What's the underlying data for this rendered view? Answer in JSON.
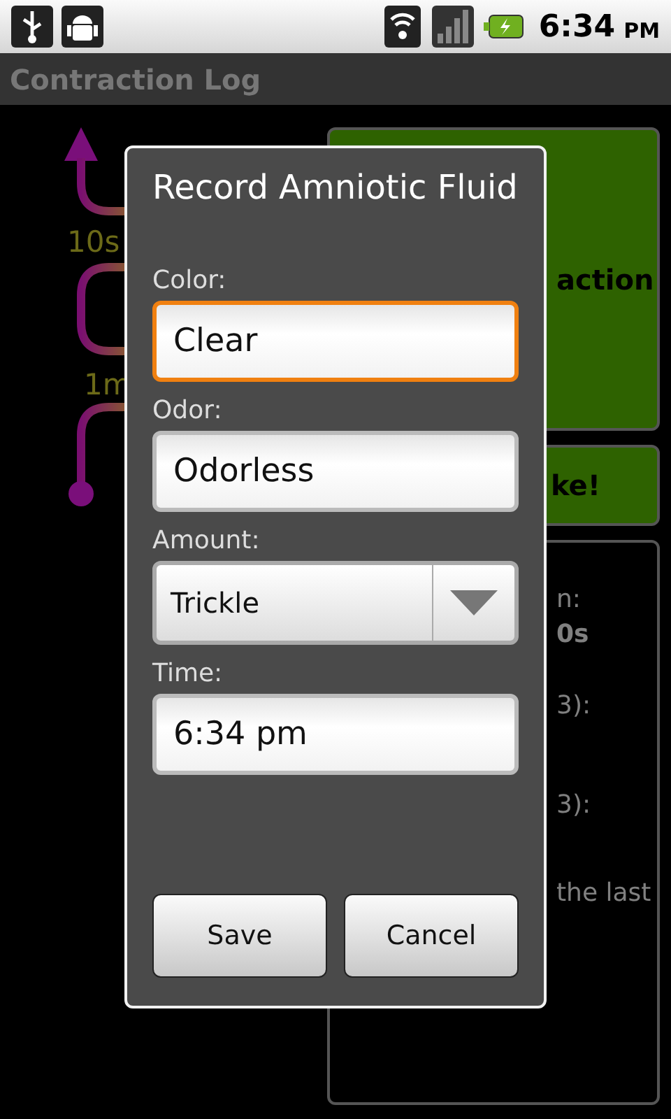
{
  "status_bar": {
    "time": "6:34",
    "meridiem": "PM"
  },
  "title_bar": {
    "title": "Contraction Log"
  },
  "timeline": {
    "labels": [
      "10s",
      "1m"
    ]
  },
  "actions": [
    {
      "label": "action",
      "kind": "start"
    },
    {
      "label": "ke!",
      "kind": "broke"
    }
  ],
  "stats": {
    "lines": [
      {
        "text": "n:",
        "bold": false
      },
      {
        "text": "0s",
        "bold": true
      },
      {
        "text": "3):",
        "bold": false
      },
      {
        "text": "3):",
        "bold": false
      },
      {
        "text": "the last",
        "bold": false
      }
    ]
  },
  "dialog": {
    "title": "Record Amniotic Fluid",
    "fields": [
      {
        "label": "Color:",
        "value": "Clear",
        "kind": "text",
        "focused": true
      },
      {
        "label": "Odor:",
        "value": "Odorless",
        "kind": "text",
        "focused": false
      },
      {
        "label": "Amount:",
        "value": "Trickle",
        "kind": "spinner",
        "focused": false
      },
      {
        "label": "Time:",
        "value": "6:34 pm",
        "kind": "text",
        "focused": false
      }
    ],
    "buttons": [
      "Save",
      "Cancel"
    ]
  }
}
